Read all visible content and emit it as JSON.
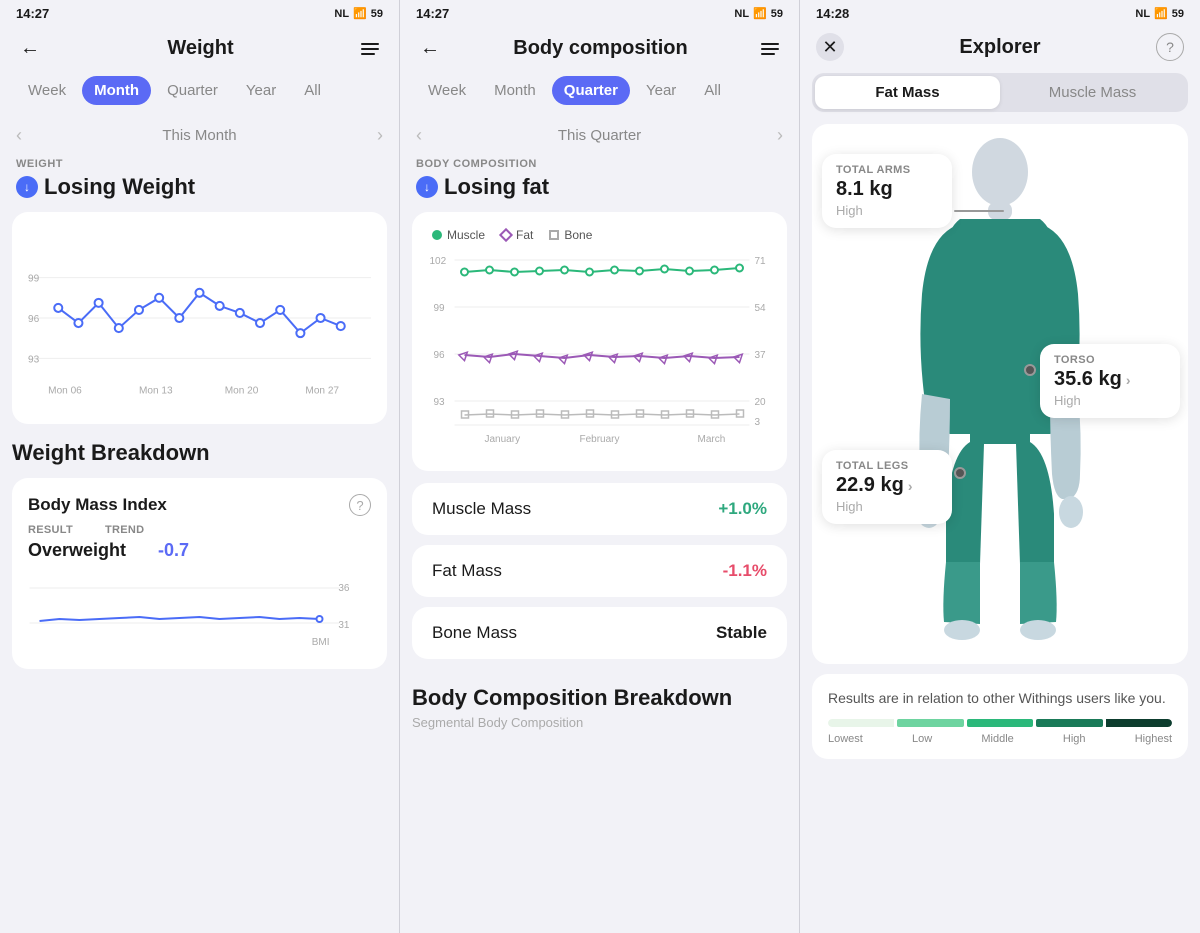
{
  "panels": {
    "weight": {
      "status_time": "14:27",
      "title": "Weight",
      "tabs": [
        "Week",
        "Month",
        "Quarter",
        "Year",
        "All"
      ],
      "active_tab": "Month",
      "period_label": "This Month",
      "section_label": "WEIGHT",
      "status_text": "Losing Weight",
      "chart_x_labels": [
        "Mon 06",
        "Mon 13",
        "Mon 20",
        "Mon 27"
      ],
      "chart_y_labels": [
        "99",
        "96",
        "93"
      ],
      "breakdown_title": "Weight Breakdown",
      "bmi_title": "Body Mass Index",
      "result_label": "RESULT",
      "trend_label": "TREND",
      "result_value": "Overweight",
      "trend_value": "-0.7",
      "bmi_y_labels": [
        "36",
        "31"
      ],
      "bmi_label": "BMI"
    },
    "body_composition": {
      "status_time": "14:27",
      "title": "Body composition",
      "tabs": [
        "Week",
        "Month",
        "Quarter",
        "Year",
        "All"
      ],
      "active_tab": "Quarter",
      "period_label": "This Quarter",
      "section_label": "BODY COMPOSITION",
      "status_text": "Losing fat",
      "legend": {
        "muscle_label": "Muscle",
        "fat_label": "Fat",
        "bone_label": "Bone"
      },
      "y_labels_left": [
        "102",
        "99",
        "96",
        "93"
      ],
      "y_labels_right": [
        "71",
        "54",
        "37",
        "20",
        "3"
      ],
      "x_labels": [
        "January",
        "February",
        "March"
      ],
      "y_left_unit": "kg",
      "y_right_unit": "%",
      "metrics": [
        {
          "name": "Muscle Mass",
          "value": "+1.0%",
          "type": "positive"
        },
        {
          "name": "Fat Mass",
          "value": "-1.1%",
          "type": "negative"
        },
        {
          "name": "Bone Mass",
          "value": "Stable",
          "type": "stable"
        }
      ],
      "breakdown_title": "Body Composition Breakdown",
      "segmental_label": "Segmental Body Composition"
    },
    "explorer": {
      "status_time": "14:28",
      "title": "Explorer",
      "toggle_options": [
        "Fat Mass",
        "Muscle Mass"
      ],
      "active_toggle": "Fat Mass",
      "annotations": {
        "arms": {
          "section_label": "TOTAL ARMS",
          "value": "8.1 kg",
          "status": "High"
        },
        "torso": {
          "section_label": "TORSO",
          "value": "35.6 kg",
          "status": "High",
          "has_arrow": true
        },
        "legs": {
          "section_label": "TOTAL LEGS",
          "value": "22.9 kg",
          "status": "High",
          "has_arrow": true
        }
      },
      "results_text": "Results are in relation to other Withings users like you.",
      "legend_labels": [
        "Lowest",
        "Low",
        "Middle",
        "High",
        "Highest"
      ],
      "legend_colors": [
        "#c8e6d0",
        "#6ed4a0",
        "#2bb87a",
        "#1a7a58",
        "#0d3d2e"
      ]
    }
  }
}
